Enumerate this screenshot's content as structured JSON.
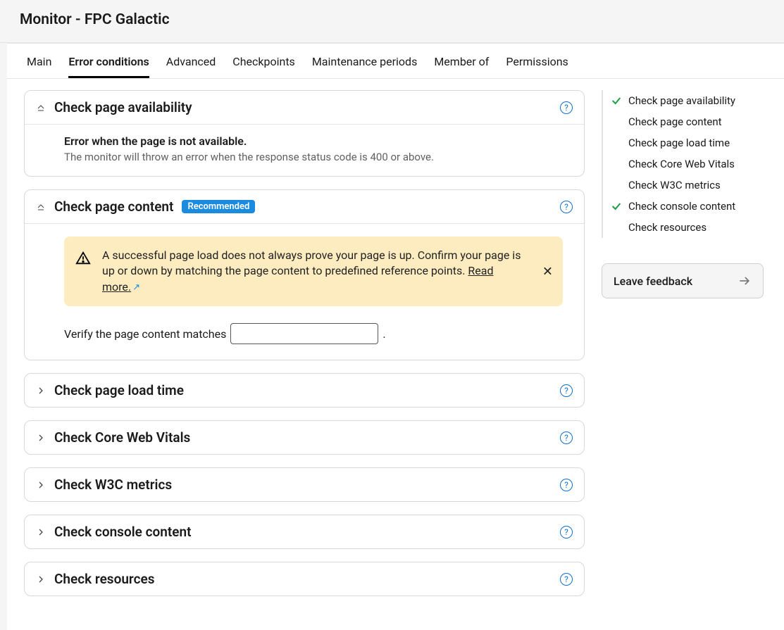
{
  "header": {
    "title": "Monitor - FPC Galactic"
  },
  "tabs": [
    {
      "label": "Main"
    },
    {
      "label": "Error conditions",
      "active": true
    },
    {
      "label": "Advanced"
    },
    {
      "label": "Checkpoints"
    },
    {
      "label": "Maintenance periods"
    },
    {
      "label": "Member of"
    },
    {
      "label": "Permissions"
    }
  ],
  "sections": {
    "availability": {
      "title": "Check page availability",
      "error_title": "Error when the page is not available.",
      "error_desc": "The monitor will throw an error when the response status code is 400 or above."
    },
    "content": {
      "title": "Check page content",
      "badge": "Recommended",
      "alert_text": "A successful page load does not always prove your page is up. Confirm your page is up or down by matching the page content to predefined reference points. ",
      "alert_link": "Read more.",
      "verify_label_pre": "Verify the page content matches",
      "verify_label_post": "."
    },
    "loadtime": {
      "title": "Check page load time"
    },
    "cwv": {
      "title": "Check Core Web Vitals"
    },
    "w3c": {
      "title": "Check W3C metrics"
    },
    "console": {
      "title": "Check console content"
    },
    "resources": {
      "title": "Check resources"
    }
  },
  "sidebar": {
    "items": [
      {
        "label": "Check page availability",
        "checked": true
      },
      {
        "label": "Check page content",
        "checked": false
      },
      {
        "label": "Check page load time",
        "checked": false
      },
      {
        "label": "Check Core Web Vitals",
        "checked": false
      },
      {
        "label": "Check W3C metrics",
        "checked": false
      },
      {
        "label": "Check console content",
        "checked": true
      },
      {
        "label": "Check resources",
        "checked": false
      }
    ],
    "feedback_label": "Leave feedback"
  }
}
